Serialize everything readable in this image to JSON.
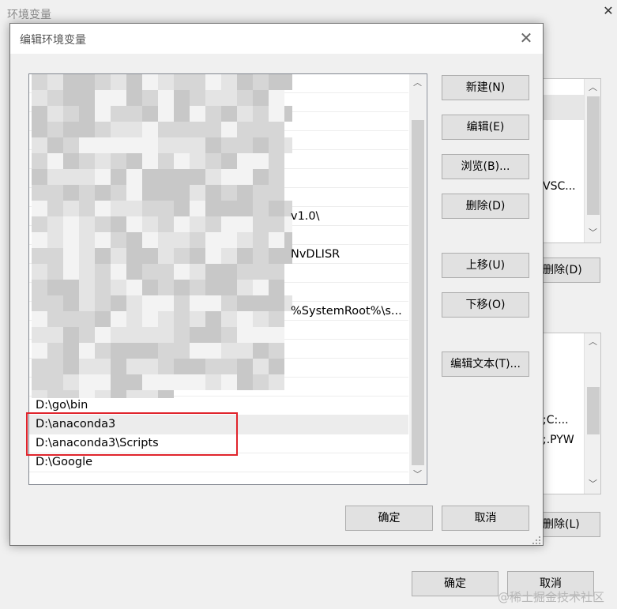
{
  "outer": {
    "title": "环境变量",
    "close_glyph": "✕",
    "user_vars": {
      "visible_text": "VSC...",
      "delete_label": "删除(D)"
    },
    "system_vars": {
      "line1": ";C:...",
      "line2": ";.PYW",
      "delete_label": "删除(L)"
    },
    "ok_label": "确定",
    "cancel_label": "取消"
  },
  "dialog": {
    "title": "编辑环境变量",
    "close_glyph": "✕",
    "buttons": {
      "new": "新建(N)",
      "edit": "编辑(E)",
      "browse": "浏览(B)...",
      "delete": "删除(D)",
      "move_up": "上移(U)",
      "move_down": "下移(O)",
      "edit_text": "编辑文本(T)...",
      "ok": "确定",
      "cancel": "取消"
    },
    "path_list": {
      "blurred_tails": [
        "v1.0\\",
        "NvDLISR",
        "%SystemRoot%\\s..."
      ],
      "items": [
        "D:\\go\\bin",
        "D:\\anaconda3",
        "D:\\anaconda3\\Scripts",
        "D:\\Google"
      ],
      "selected_index": 1,
      "highlighted_items": [
        "D:\\anaconda3",
        "D:\\anaconda3\\Scripts"
      ]
    },
    "scroll_up": "▲",
    "scroll_down": "▼"
  },
  "watermark": "@稀土掘金技术社区",
  "icons": [
    "close-icon",
    "scroll-up-icon",
    "scroll-down-icon",
    "resize-grip-icon"
  ]
}
